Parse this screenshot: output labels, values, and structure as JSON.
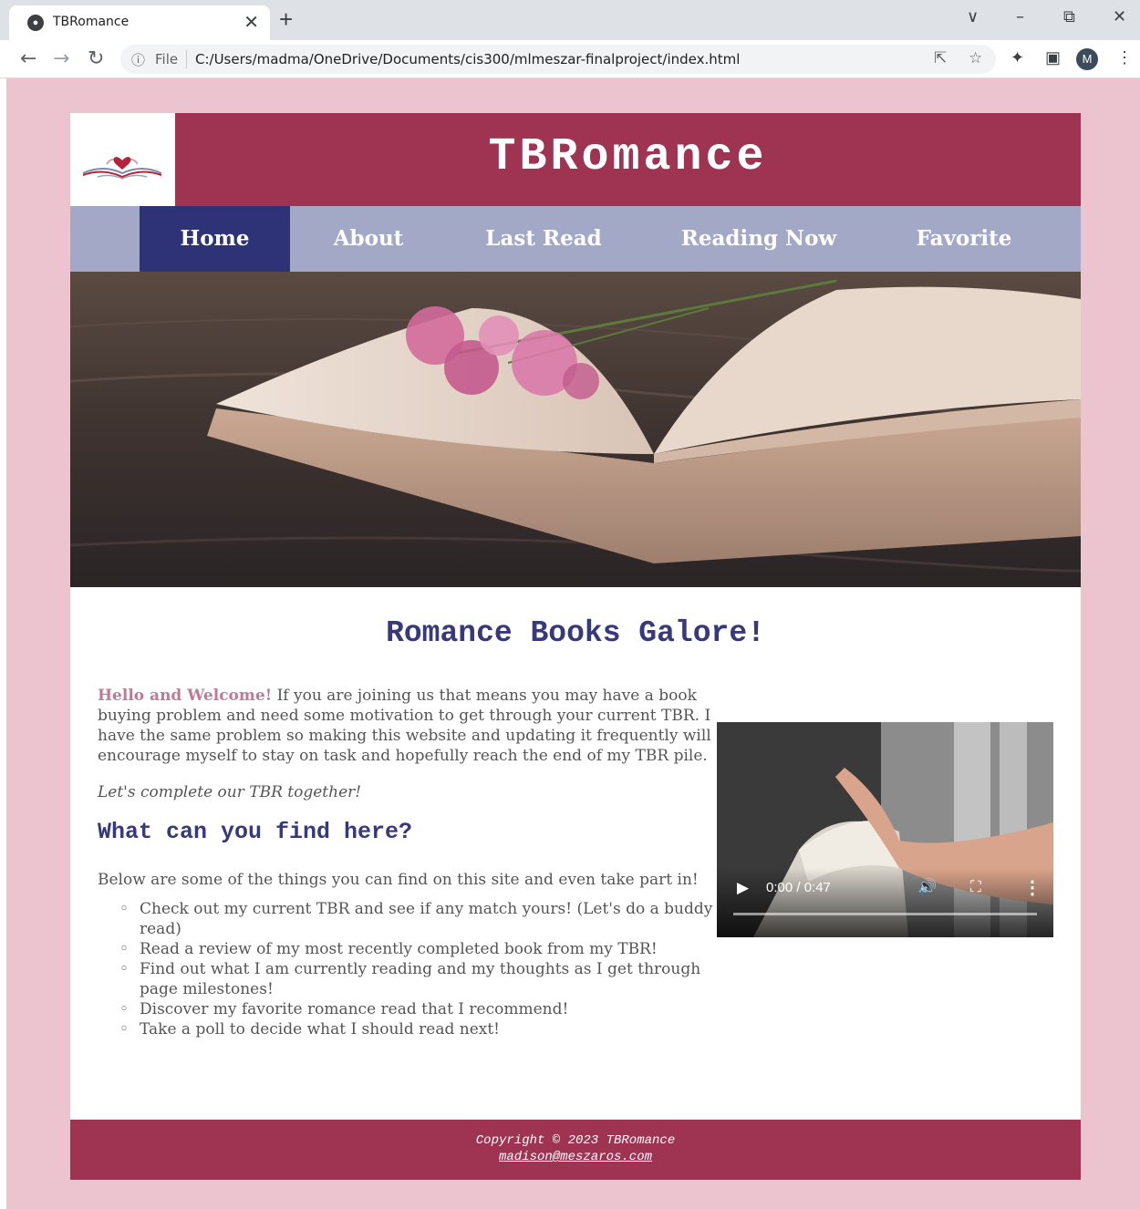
{
  "browser": {
    "tab_title": "TBRomance",
    "scheme_label": "File",
    "url": "C:/Users/madma/OneDrive/Documents/cis300/mlmeszar-finalproject/index.html",
    "profile_initial": "M"
  },
  "site": {
    "title": "TBRomance",
    "nav": {
      "home": "Home",
      "about": "About",
      "last_read": "Last Read",
      "reading_now": "Reading Now",
      "favorite": "Favorite"
    },
    "main_heading": "Romance Books Galore!",
    "welcome": "Hello and Welcome!",
    "intro": " If you are joining us that means you may have a book buying problem and need some motivation to get through your current TBR. I have the same problem so making this website and updating it frequently will encourage myself to stay on task and hopefully reach the end of my TBR pile.",
    "tagline": "Let's complete our TBR together!",
    "sub_heading": "What can you find here?",
    "list_intro": "Below are some of the things you can find on this site and even take part in!",
    "features": [
      "Check out my current TBR and see if any match yours! (Let's do a buddy read)",
      "Read a review of my most recently completed book from my TBR!",
      "Find out what I am currently reading and my thoughts as I get through page milestones!",
      "Discover my favorite romance read that I recommend!",
      "Take a poll to decide what I should read next!"
    ],
    "video": {
      "time": "0:00 / 0:47",
      "progress": 0
    },
    "footer": {
      "copyright": "Copyright © 2023 TBRomance",
      "email": "madison@meszaros.com"
    }
  },
  "colors": {
    "page_bg": "#ecc4d0",
    "header_bg": "#9e3451",
    "nav_bg": "#a3a8c7",
    "nav_active": "#2e3377",
    "heading": "#38397b",
    "welcome": "#c07a92"
  },
  "icons": [
    "globe-icon",
    "close-icon",
    "plus-icon",
    "back-icon",
    "forward-icon",
    "reload-icon",
    "info-icon",
    "share-icon",
    "star-icon",
    "extensions-icon",
    "sidepanel-icon",
    "menu-icon",
    "heart-book-logo",
    "play-icon",
    "volume-icon",
    "fullscreen-icon",
    "more-icon"
  ]
}
